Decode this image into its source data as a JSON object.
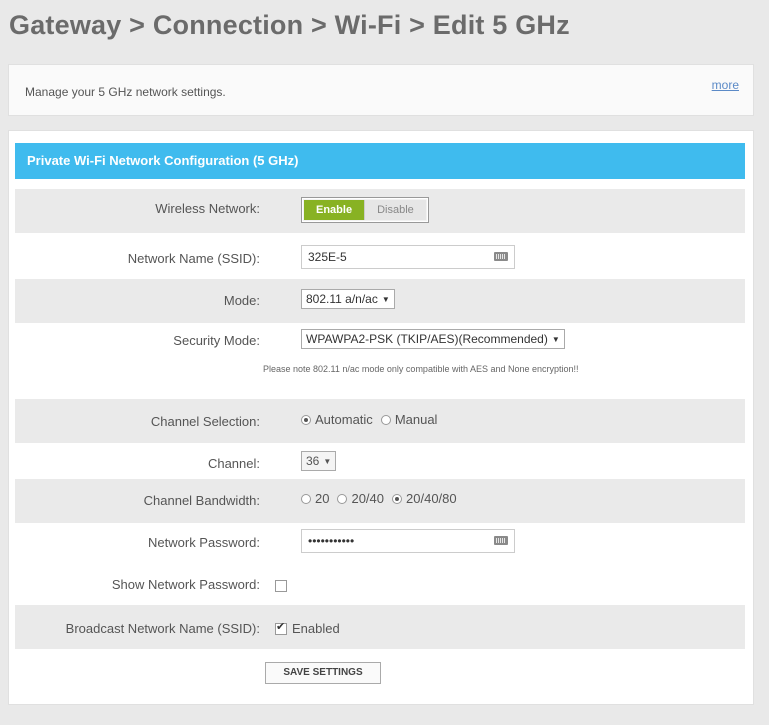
{
  "page_title": "Gateway > Connection > Wi-Fi > Edit 5 GHz",
  "info": {
    "text": "Manage your 5 GHz network settings.",
    "more_link": "more"
  },
  "config": {
    "header": "Private Wi-Fi Network Configuration (5 GHz)",
    "wireless_network": {
      "label": "Wireless Network:",
      "enable": "Enable",
      "disable": "Disable",
      "selected": "Enable"
    },
    "ssid": {
      "label": "Network Name (SSID):",
      "value": "325E-5"
    },
    "mode": {
      "label": "Mode:",
      "value": "802.11 a/n/ac"
    },
    "security_mode": {
      "label": "Security Mode:",
      "value": "WPAWPA2-PSK (TKIP/AES)(Recommended)"
    },
    "note": "Please note 802.11 n/ac mode only compatible with AES and None encryption!!",
    "channel_selection": {
      "label": "Channel Selection:",
      "options": [
        "Automatic",
        "Manual"
      ],
      "selected": "Automatic"
    },
    "channel": {
      "label": "Channel:",
      "value": "36"
    },
    "channel_bandwidth": {
      "label": "Channel Bandwidth:",
      "options": [
        "20",
        "20/40",
        "20/40/80"
      ],
      "selected": "20/40/80"
    },
    "password": {
      "label": "Network Password:",
      "value": "•••••••••••"
    },
    "show_password": {
      "label": "Show Network Password:",
      "checked": false
    },
    "broadcast_ssid": {
      "label": "Broadcast Network Name (SSID):",
      "checked": true,
      "text": "Enabled"
    },
    "save_button": "SAVE SETTINGS"
  },
  "colors": {
    "header_bg": "#3fbbee",
    "enable_green": "#88b223",
    "link_blue": "#5b8ac7"
  }
}
